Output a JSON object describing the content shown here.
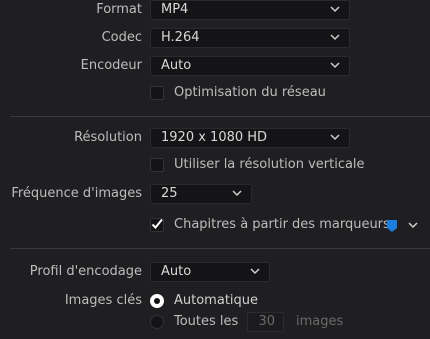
{
  "format": {
    "label": "Format",
    "value": "MP4"
  },
  "codec": {
    "label": "Codec",
    "value": "H.264"
  },
  "encoder": {
    "label": "Encodeur",
    "value": "Auto"
  },
  "network_optimization": {
    "label": "Optimisation du réseau",
    "checked": false
  },
  "resolution": {
    "label": "Résolution",
    "value": "1920 x 1080 HD"
  },
  "vertical_resolution": {
    "label": "Utiliser la résolution verticale",
    "checked": false
  },
  "frame_rate": {
    "label": "Fréquence d'images",
    "value": "25"
  },
  "chapters": {
    "label": "Chapitres à partir des marqueurs",
    "checked": true,
    "marker_color": "#1e7ee0"
  },
  "encoding_profile": {
    "label": "Profil d'encodage",
    "value": "Auto"
  },
  "keyframes": {
    "label": "Images clés",
    "automatic_label": "Automatique",
    "every_label": "Toutes les",
    "every_value": "30",
    "every_unit": "images",
    "selected": "automatic"
  }
}
